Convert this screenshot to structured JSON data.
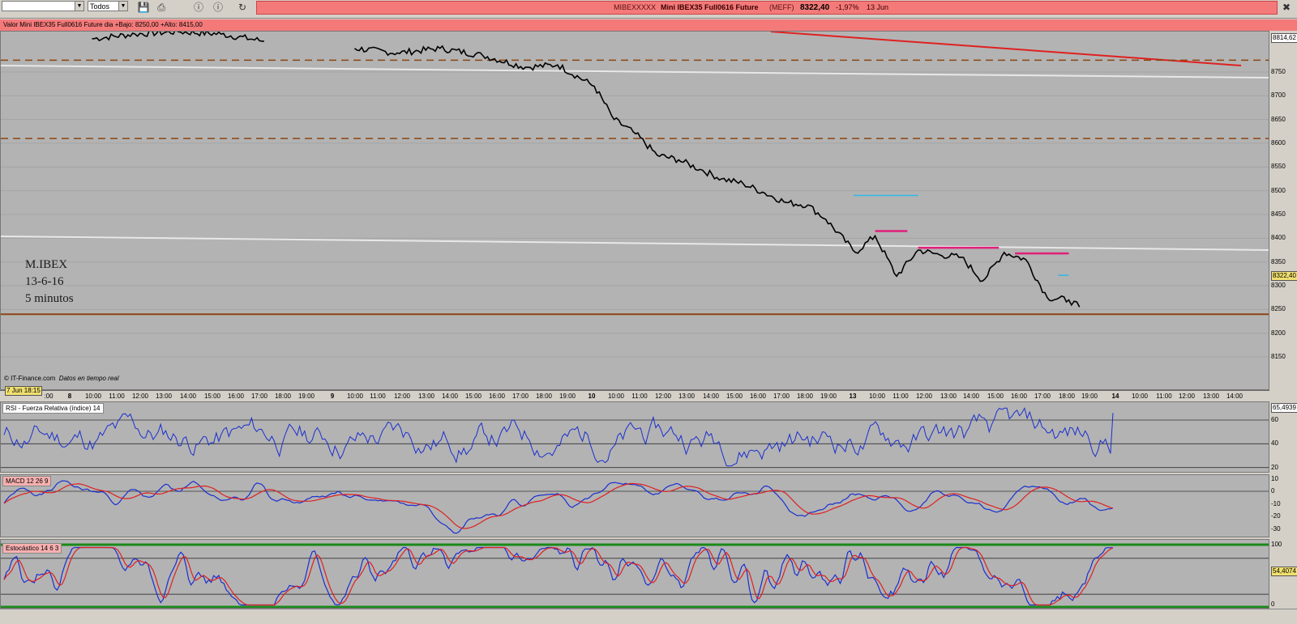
{
  "toolbar": {
    "dropdown1_value": "",
    "dropdown2_value": "Todos",
    "ticker": "MIBEXXXXX",
    "instrument": "Mini IBEX35 Full0616 Future",
    "market": "(MEFF)",
    "last_price": "8322,40",
    "change_pct": "-1,97%",
    "date": "13 Jun"
  },
  "price_panel": {
    "header": "Valor   Mini IBEX35 Full0616 Future   dia +Bajo: 8250,00 +Alto: 8415,00",
    "annotation_lines": [
      "M.IBEX",
      "13-6-16",
      "5 minutos"
    ],
    "footer": "© IT-Finance.com",
    "footer_note": "Datos en tiempo real",
    "y_ticks": [
      "8814,62",
      "8750",
      "8700",
      "8650",
      "8600",
      "8550",
      "8500",
      "8450",
      "8400",
      "8350",
      "8322,40",
      "8300",
      "8250",
      "8200",
      "8150"
    ],
    "current_value": "8322,40",
    "y_top_value": "8814,62"
  },
  "time_axis": {
    "date_badge": "7 Jun 18:15",
    "ticks": [
      {
        "t": ":00",
        "b": false
      },
      {
        "t": "8",
        "b": true
      },
      {
        "t": "10:00",
        "b": false
      },
      {
        "t": "11:00",
        "b": false
      },
      {
        "t": "12:00",
        "b": false
      },
      {
        "t": "13:00",
        "b": false
      },
      {
        "t": "14:00",
        "b": false
      },
      {
        "t": "15:00",
        "b": false
      },
      {
        "t": "16:00",
        "b": false
      },
      {
        "t": "17:00",
        "b": false
      },
      {
        "t": "18:00",
        "b": false
      },
      {
        "t": "19:00",
        "b": false
      },
      {
        "t": "9",
        "b": true
      },
      {
        "t": "10:00",
        "b": false
      },
      {
        "t": "11:00",
        "b": false
      },
      {
        "t": "12:00",
        "b": false
      },
      {
        "t": "13:00",
        "b": false
      },
      {
        "t": "14:00",
        "b": false
      },
      {
        "t": "15:00",
        "b": false
      },
      {
        "t": "16:00",
        "b": false
      },
      {
        "t": "17:00",
        "b": false
      },
      {
        "t": "18:00",
        "b": false
      },
      {
        "t": "19:00",
        "b": false
      },
      {
        "t": "10",
        "b": true
      },
      {
        "t": "10:00",
        "b": false
      },
      {
        "t": "11:00",
        "b": false
      },
      {
        "t": "12:00",
        "b": false
      },
      {
        "t": "13:00",
        "b": false
      },
      {
        "t": "14:00",
        "b": false
      },
      {
        "t": "15:00",
        "b": false
      },
      {
        "t": "16:00",
        "b": false
      },
      {
        "t": "17:00",
        "b": false
      },
      {
        "t": "18:00",
        "b": false
      },
      {
        "t": "19:00",
        "b": false
      },
      {
        "t": "13",
        "b": true
      },
      {
        "t": "10:00",
        "b": false
      },
      {
        "t": "11:00",
        "b": false
      },
      {
        "t": "12:00",
        "b": false
      },
      {
        "t": "13:00",
        "b": false
      },
      {
        "t": "14:00",
        "b": false
      },
      {
        "t": "15:00",
        "b": false
      },
      {
        "t": "16:00",
        "b": false
      },
      {
        "t": "17:00",
        "b": false
      },
      {
        "t": "18:00",
        "b": false
      },
      {
        "t": "19:00",
        "b": false
      },
      {
        "t": "14",
        "b": true
      },
      {
        "t": "10:00",
        "b": false
      },
      {
        "t": "11:00",
        "b": false
      },
      {
        "t": "12:00",
        "b": false
      },
      {
        "t": "13:00",
        "b": false
      },
      {
        "t": "14:00",
        "b": false
      }
    ]
  },
  "rsi_panel": {
    "label": "RSI - Fuerza Relativa (índice) 14",
    "value": "65,4939",
    "y_ticks": [
      "60",
      "40",
      "20"
    ]
  },
  "macd_panel": {
    "label": "MACD 12 26 9",
    "y_ticks": [
      "10",
      "0",
      "-10",
      "-20",
      "-30"
    ]
  },
  "stoch_panel": {
    "label": "Estocástico 14 6 3",
    "value": "54,4074",
    "y_ticks": [
      "100",
      "0"
    ]
  },
  "colors": {
    "titlebar": "#f47a7a",
    "panel_bg": "#b3b3b3",
    "resistance_red": "#e02020",
    "dashed_brown": "#8b4513",
    "magenta": "#e0207a",
    "cyan": "#30b8e8",
    "rsi_line": "#1a2fd0",
    "signal_line": "#e02020"
  },
  "chart_data": {
    "type": "line",
    "title": "Mini IBEX35 Full0616 Future",
    "xlabel": "",
    "ylabel": "",
    "ylim": [
      8100,
      8814.62
    ],
    "x": [
      "8 10:00",
      "8 12:00",
      "8 14:00",
      "8 16:00",
      "8 18:00",
      "9 10:00",
      "9 12:00",
      "9 14:00",
      "9 16:00",
      "9 18:00",
      "9 19:30",
      "10 09:05",
      "10 10:00",
      "10 11:00",
      "10 12:00",
      "10 13:00",
      "10 14:00",
      "10 15:00",
      "10 16:00",
      "10 17:00",
      "10 18:00",
      "10 19:00",
      "10 19:50",
      "13 09:05",
      "13 10:00",
      "13 11:00",
      "13 12:00",
      "13 13:00",
      "13 14:00",
      "13 15:00",
      "13 16:00",
      "13 17:00",
      "13 18:00",
      "13 19:00",
      "13 19:30"
    ],
    "series": [
      {
        "name": "Mini IBEX35 Full0616 Future",
        "values": [
          8820,
          8830,
          8835,
          8830,
          8815,
          8800,
          8790,
          8800,
          8785,
          8760,
          8765,
          8720,
          8650,
          8620,
          8575,
          8565,
          8545,
          8525,
          8515,
          8495,
          8475,
          8470,
          8440,
          8370,
          8405,
          8320,
          8375,
          8365,
          8360,
          8310,
          8370,
          8355,
          8275,
          8270,
          8255
        ]
      }
    ],
    "horizontal_levels": [
      {
        "value": 8775,
        "style": "dashed",
        "color": "#8b4513"
      },
      {
        "value": 8610,
        "style": "dashed",
        "color": "#8b4513"
      },
      {
        "value": 8240,
        "style": "solid",
        "color": "#8b4513"
      }
    ],
    "annotation_segments": [
      {
        "from": "13 09:00",
        "to": "13 12:00",
        "value": 8490,
        "color": "#30b8e8"
      },
      {
        "from": "13 10:00",
        "to": "13 11:30",
        "value": 8415,
        "color": "#e0207a"
      },
      {
        "from": "13 12:00",
        "to": "13 15:45",
        "value": 8380,
        "color": "#e0207a"
      },
      {
        "from": "13 16:30",
        "to": "13 19:00",
        "value": 8368,
        "color": "#e0207a"
      },
      {
        "from": "13 18:30",
        "to": "13 19:00",
        "value": 8322,
        "color": "#30b8e8"
      }
    ]
  }
}
